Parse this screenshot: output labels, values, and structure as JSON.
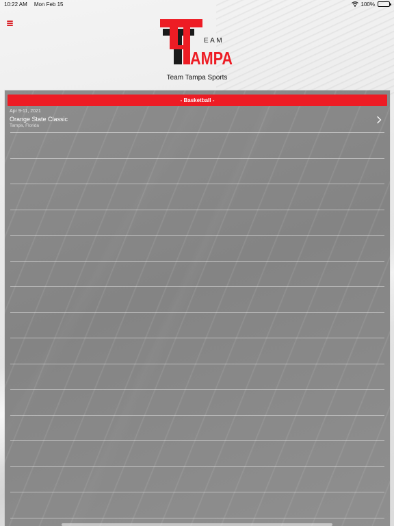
{
  "status_bar": {
    "time": "10:22 AM",
    "date": "Mon Feb 15",
    "battery": "100%"
  },
  "header": {
    "logo_text_top": "EAM",
    "logo_text_bottom": "AMPA",
    "site_title": "Team Tampa Sports"
  },
  "colors": {
    "brand_red": "#ed1c24",
    "logo_black": "#1a1a1a"
  },
  "category": {
    "label": "- Basketball -"
  },
  "events": [
    {
      "date": "Apr 9-11, 2021",
      "name": "Orange State Classic",
      "location": "Tampa, Florida"
    }
  ]
}
